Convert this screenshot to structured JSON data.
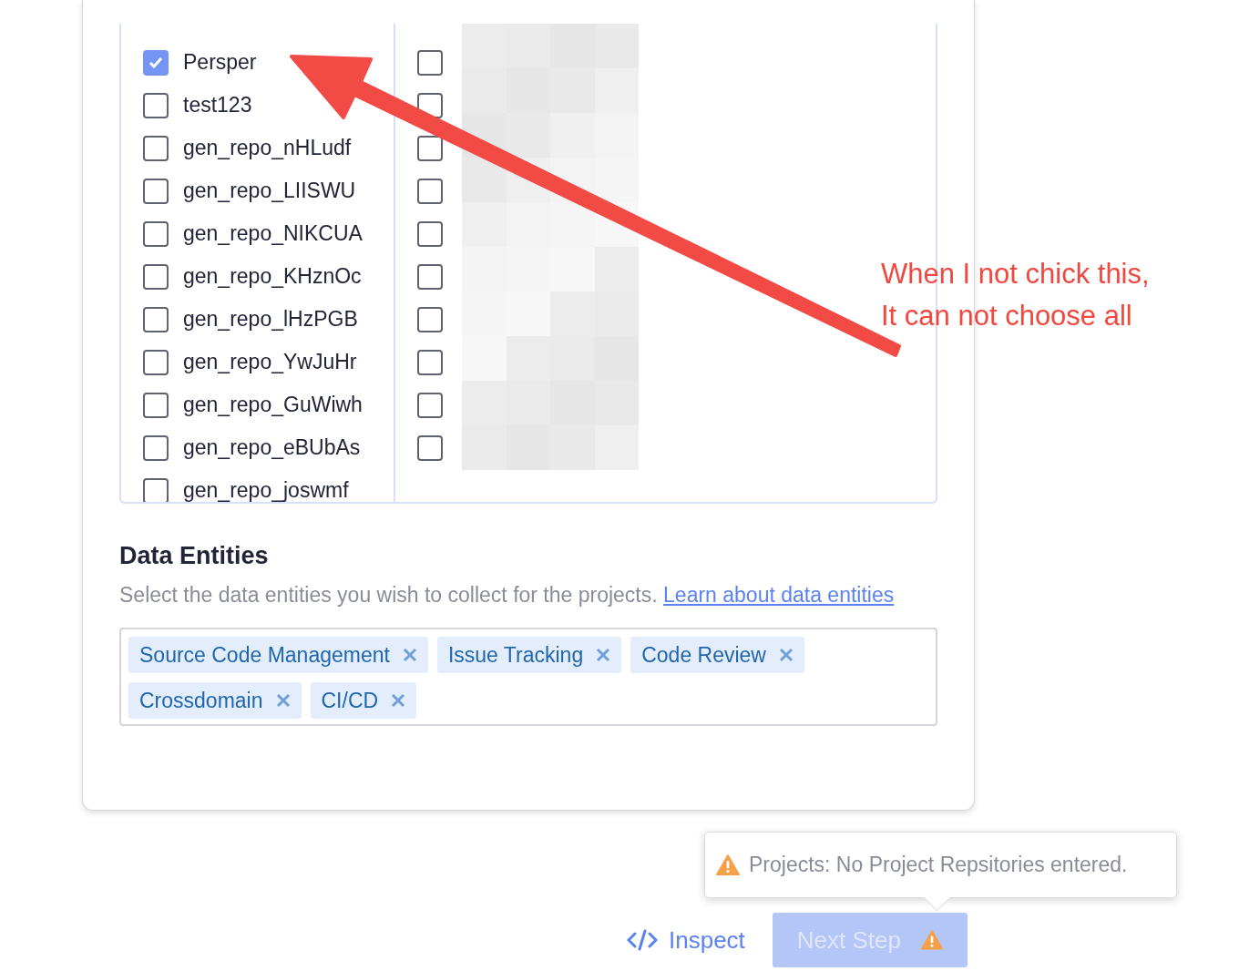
{
  "project_list": {
    "left": [
      {
        "label": "Persper",
        "checked": true
      },
      {
        "label": "test123",
        "checked": false
      },
      {
        "label": "gen_repo_nHLudf",
        "checked": false
      },
      {
        "label": "gen_repo_LIISWU",
        "checked": false
      },
      {
        "label": "gen_repo_NIKCUA",
        "checked": false
      },
      {
        "label": "gen_repo_KHznOc",
        "checked": false
      },
      {
        "label": "gen_repo_lHzPGB",
        "checked": false
      },
      {
        "label": "gen_repo_YwJuHr",
        "checked": false
      },
      {
        "label": "gen_repo_GuWiwh",
        "checked": false
      },
      {
        "label": "gen_repo_eBUbAs",
        "checked": false
      },
      {
        "label": "gen_repo_joswmf",
        "checked": false
      }
    ],
    "right": [
      {
        "checked": false
      },
      {
        "checked": false
      },
      {
        "checked": false
      },
      {
        "checked": false
      },
      {
        "checked": false
      },
      {
        "checked": false
      },
      {
        "checked": false
      },
      {
        "checked": false
      },
      {
        "checked": false
      },
      {
        "checked": false
      }
    ]
  },
  "data_entities": {
    "title": "Data Entities",
    "description": "Select the data entities you wish to collect for the projects.",
    "link": "Learn about data entities",
    "tags": [
      "Source Code Management",
      "Issue Tracking",
      "Code Review",
      "Crossdomain",
      "CI/CD"
    ]
  },
  "annotation": {
    "lines": [
      "When I not chick this,",
      "It can not choose all"
    ]
  },
  "tooltip": {
    "message": "Projects: No Project Repsitories entered."
  },
  "actions": {
    "inspect": "Inspect",
    "next": {
      "label": "Next Step",
      "disabled": true
    }
  }
}
